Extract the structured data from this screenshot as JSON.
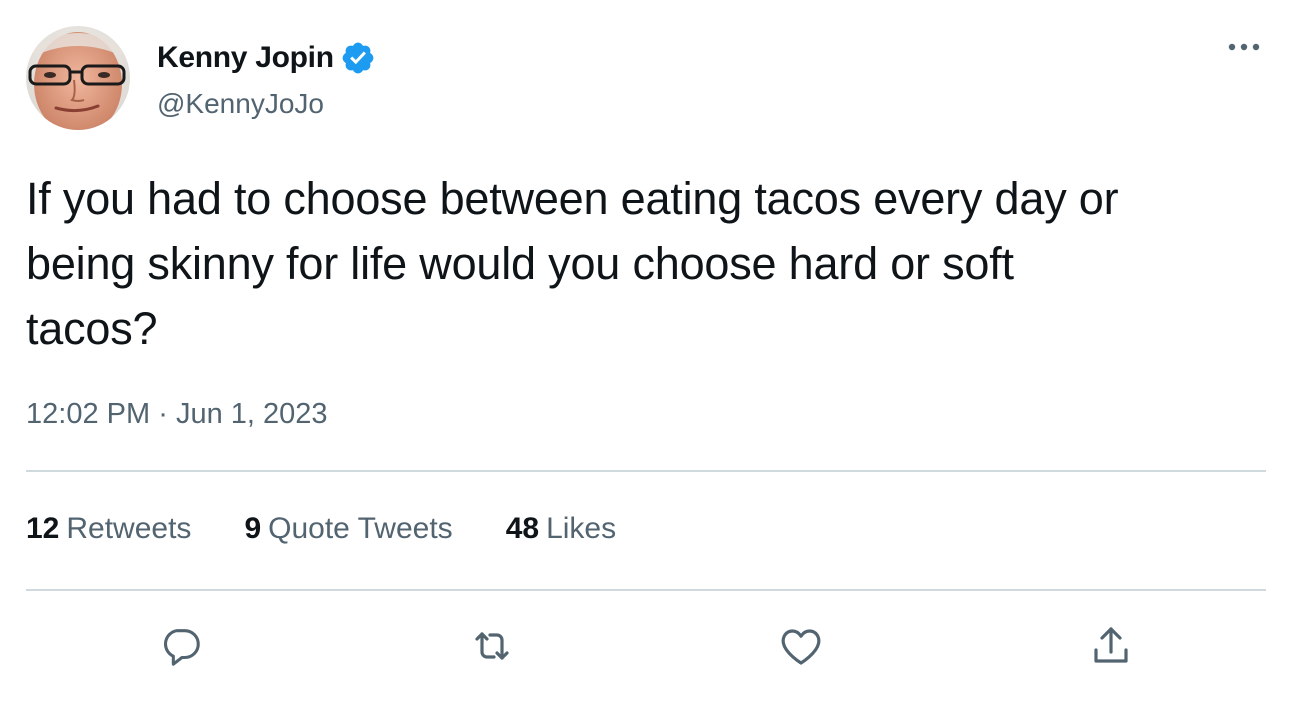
{
  "author": {
    "name": "Kenny Jopin",
    "handle": "@KennyJoJo",
    "verified": true
  },
  "tweet": {
    "text": "If you had to choose between eating tacos every day or\nbeing skinny for life would you choose hard or soft\ntacos?",
    "time": "12:02 PM",
    "separator": "·",
    "date": "Jun 1, 2023"
  },
  "stats": {
    "retweets_count": "12",
    "retweets_label": "Retweets",
    "quotes_count": "9",
    "quotes_label": "Quote Tweets",
    "likes_count": "48",
    "likes_label": "Likes"
  },
  "icons": {
    "more": "more-horizontal-icon",
    "verified": "verified-badge-icon",
    "reply": "reply-icon",
    "retweet": "retweet-icon",
    "like": "heart-icon",
    "share": "share-icon"
  },
  "colors": {
    "text_primary": "#0f1419",
    "text_secondary": "#536471",
    "verified_blue": "#1d9bf0",
    "divider": "#cfd9de"
  }
}
